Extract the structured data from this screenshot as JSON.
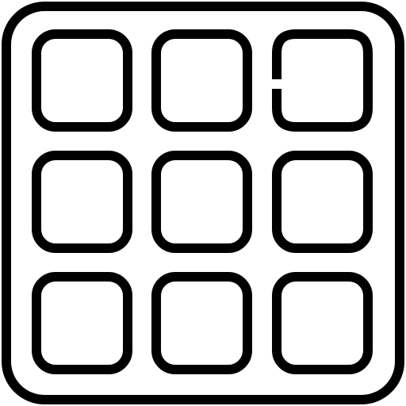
{
  "icon": {
    "name": "grid-3x3-icon",
    "rows": 3,
    "columns": 3,
    "stroke_color": "#000000",
    "background_color": "#ffffff",
    "cells": [
      {
        "row": 1,
        "column": 1,
        "style": "closed"
      },
      {
        "row": 1,
        "column": 2,
        "style": "closed"
      },
      {
        "row": 1,
        "column": 3,
        "style": "open-left-edge"
      },
      {
        "row": 2,
        "column": 1,
        "style": "closed"
      },
      {
        "row": 2,
        "column": 2,
        "style": "closed"
      },
      {
        "row": 2,
        "column": 3,
        "style": "closed"
      },
      {
        "row": 3,
        "column": 1,
        "style": "closed"
      },
      {
        "row": 3,
        "column": 2,
        "style": "closed"
      },
      {
        "row": 3,
        "column": 3,
        "style": "closed"
      }
    ]
  }
}
